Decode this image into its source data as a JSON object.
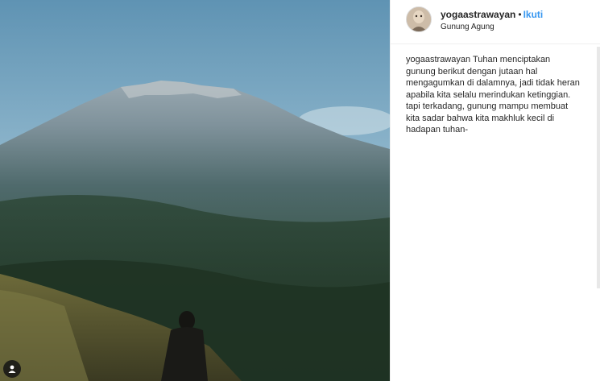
{
  "post": {
    "username": "yogaastrawayan",
    "separator": "•",
    "follow_label": "Ikuti",
    "location": "Gunung Agung",
    "caption_user": "yogaastrawayan",
    "caption_text": "Tuhan menciptakan gunung berikut dengan jutaan hal mengagumkan di dalamnya, jadi tidak heran apabila kita selalu merindukan ketinggian. tapi terkadang, gunung mampu membuat kita sadar bahwa kita makhluk kecil di hadapan tuhan-"
  },
  "icons": {
    "tag": "user-tag-icon"
  },
  "colors": {
    "link": "#3897f0",
    "text": "#262626",
    "border": "#efefef"
  }
}
